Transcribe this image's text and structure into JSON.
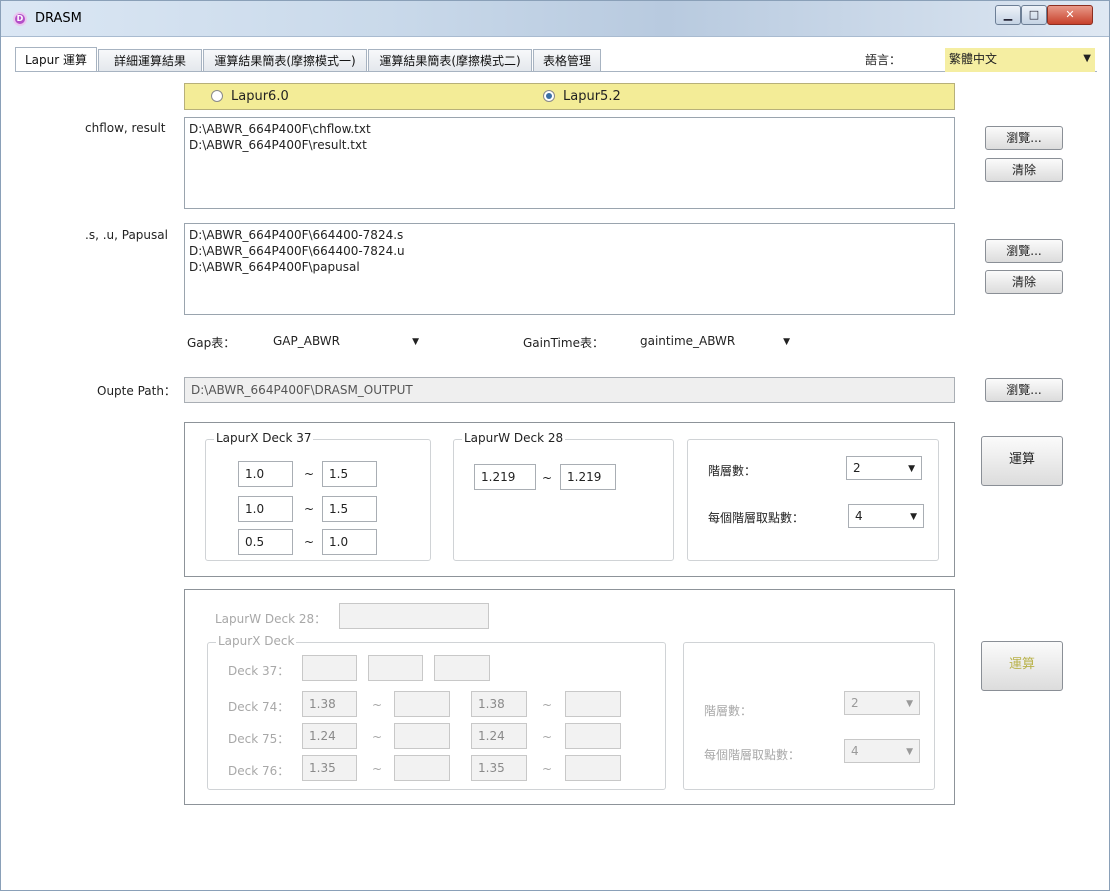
{
  "window": {
    "title": "DRASM",
    "icon": "app-logo-icon"
  },
  "tabs": [
    {
      "label": "Lapur 運算",
      "active": true
    },
    {
      "label": "詳細運算結果",
      "active": false
    },
    {
      "label": "運算結果簡表(摩擦模式一)",
      "active": false
    },
    {
      "label": "運算結果簡表(摩擦模式二)",
      "active": false
    },
    {
      "label": "表格管理",
      "active": false
    }
  ],
  "language": {
    "label": "語言：",
    "value": "繁體中文",
    "highlight_color": "#f5eea2"
  },
  "version": {
    "options": [
      "Lapur6.0",
      "Lapur5.2"
    ],
    "selected": "Lapur5.2",
    "bar_color": "#f3ec97"
  },
  "chflow": {
    "label": "chflow, result",
    "files": [
      "D:\\ABWR_664P400F\\chflow.txt",
      "D:\\ABWR_664P400F\\result.txt"
    ],
    "browse": "瀏覽...",
    "clear": "清除"
  },
  "su": {
    "label": ".s, .u, Papusal",
    "files": [
      "D:\\ABWR_664P400F\\664400-7824.s",
      "D:\\ABWR_664P400F\\664400-7824.u",
      "D:\\ABWR_664P400F\\papusal"
    ],
    "browse": "瀏覽...",
    "clear": "清除"
  },
  "gap": {
    "label": "Gap表：",
    "value": "GAP_ABWR"
  },
  "gaintime": {
    "label": "GainTime表：",
    "value": "gaintime_ABWR"
  },
  "output": {
    "label": "Oupte Path：",
    "value": "D:\\ABWR_664P400F\\DRASM_OUTPUT",
    "browse": "瀏覽..."
  },
  "panel1": {
    "lapurx": {
      "title": "LapurX Deck 37",
      "rows": [
        {
          "from": "1.0",
          "to": "1.5"
        },
        {
          "from": "1.0",
          "to": "1.5"
        },
        {
          "from": "0.5",
          "to": "1.0"
        }
      ]
    },
    "lapurw": {
      "title": "LapurW Deck 28",
      "from": "1.219",
      "to": "1.219"
    },
    "levels": {
      "label": "階層數：",
      "value": "2"
    },
    "points": {
      "label": "每個階層取點數：",
      "value": "4"
    },
    "calc": "運算",
    "tilde": "~"
  },
  "panel2": {
    "lapurw_label": "LapurW Deck 28：",
    "lapurw_value": "",
    "lapurx_title": "LapurX Deck",
    "deck37": {
      "label": "Deck 37：",
      "values": [
        "",
        "",
        ""
      ]
    },
    "decks": [
      {
        "label": "Deck 74：",
        "a": "1.38",
        "b": "",
        "c": "1.38",
        "d": ""
      },
      {
        "label": "Deck 75：",
        "a": "1.24",
        "b": "",
        "c": "1.24",
        "d": ""
      },
      {
        "label": "Deck 76：",
        "a": "1.35",
        "b": "",
        "c": "1.35",
        "d": ""
      }
    ],
    "levels": {
      "label": "階層數：",
      "value": "2"
    },
    "points": {
      "label": "每個階層取點數：",
      "value": "4"
    },
    "calc": "運算",
    "tilde": "~"
  }
}
